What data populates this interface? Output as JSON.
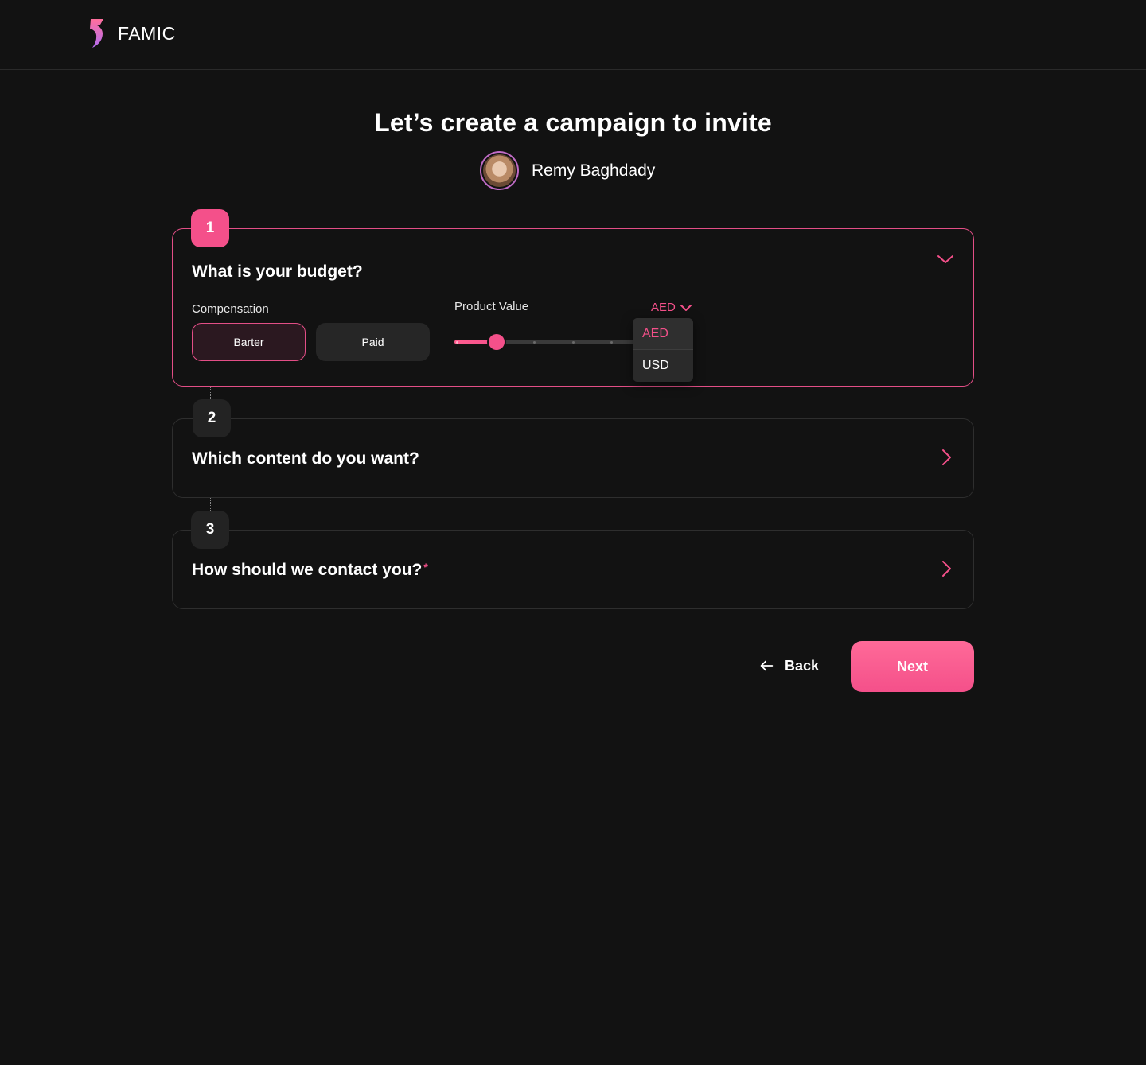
{
  "brand": {
    "name": "FAMIC",
    "accent": "#f4508a"
  },
  "header": {
    "title": "Let’s create a campaign to invite",
    "influencer_name": "Remy Baghdady"
  },
  "steps": [
    {
      "number": "1",
      "title": "What is your budget?",
      "expanded": true,
      "compensation": {
        "label": "Compensation",
        "options": [
          "Barter",
          "Paid"
        ],
        "selected": "Barter"
      },
      "product_value": {
        "label": "Product Value",
        "slider_fraction": 0.22
      },
      "currency": {
        "selected": "AED",
        "options": [
          "AED",
          "USD"
        ]
      }
    },
    {
      "number": "2",
      "title": "Which content do you want?",
      "expanded": false
    },
    {
      "number": "3",
      "title": "How should we contact you?",
      "required_mark": "*",
      "expanded": false
    }
  ],
  "footer": {
    "back_label": "Back",
    "next_label": "Next"
  },
  "icons": {
    "logo": "famic-logo-icon",
    "collapse": "chevron-down-icon",
    "expand": "chevron-right-icon",
    "back": "arrow-left-icon"
  }
}
